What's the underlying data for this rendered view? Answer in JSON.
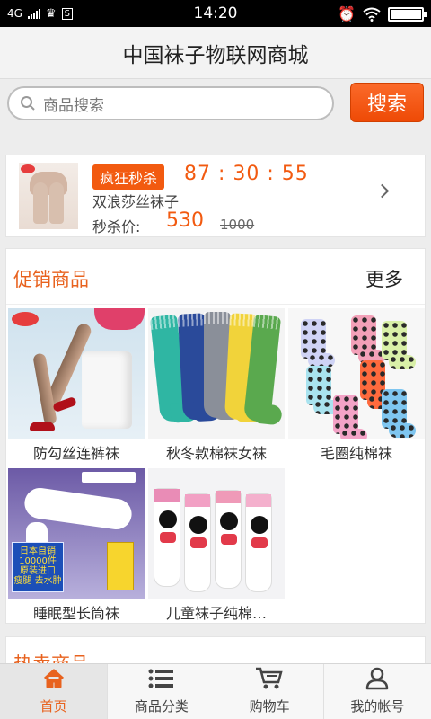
{
  "status_bar": {
    "network": "4G",
    "time": "14:20",
    "battery_level": 1.0
  },
  "header": {
    "title": "中国袜子物联网商城"
  },
  "search": {
    "placeholder": "商品搜索",
    "button_label": "搜索"
  },
  "flash_sale": {
    "badge": "疯狂秒杀",
    "countdown": "87 : 30 : 55",
    "product_name": "双浪莎丝袜子",
    "price_label": "秒杀价:",
    "price": "530",
    "original_price": "1000"
  },
  "promo": {
    "title": "促销商品",
    "more_label": "更多",
    "products": [
      {
        "label": "防勾丝连裤袜"
      },
      {
        "label": "秋冬款棉袜女袜"
      },
      {
        "label": "毛圈纯棉袜"
      },
      {
        "label": "睡眠型长筒袜"
      },
      {
        "label": "儿童袜子纯棉…"
      }
    ]
  },
  "sleep_badge": {
    "line1": "日本自销",
    "line2": "10000件",
    "line3": "原装进口",
    "line4": "瘦腿 去水肿"
  },
  "hot": {
    "title": "热卖商品"
  },
  "bottom_nav": {
    "items": [
      {
        "label": "首页",
        "icon": "home-icon",
        "active": true
      },
      {
        "label": "商品分类",
        "icon": "list-icon",
        "active": false
      },
      {
        "label": "购物车",
        "icon": "cart-icon",
        "active": false
      },
      {
        "label": "我的帐号",
        "icon": "user-icon",
        "active": false
      }
    ]
  },
  "colors": {
    "accent": "#e8621e",
    "button": "#f25a10"
  }
}
